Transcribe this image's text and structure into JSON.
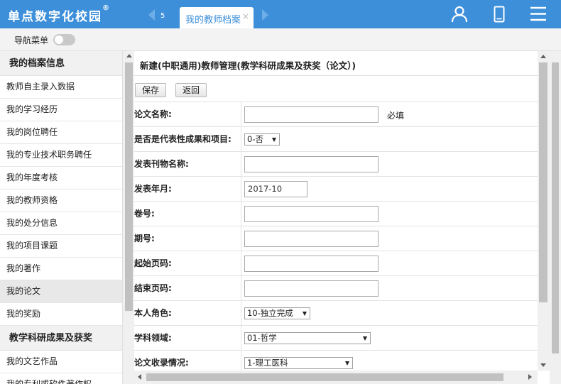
{
  "app": {
    "logo_text": "单点数字化校园",
    "logo_mark": "®"
  },
  "tabs": {
    "ghost_label": "5",
    "active_label": "我的教师档案",
    "close_glyph": "×"
  },
  "header_icons": [
    "user-icon",
    "mobile-icon",
    "menu-icon"
  ],
  "navbar": {
    "label": "导航菜单",
    "toggle_on": false
  },
  "sidebar": {
    "sections": [
      {
        "title": "我的档案信息",
        "items": [
          {
            "label": "教师自主录入数据",
            "active": false
          },
          {
            "label": "我的学习经历",
            "active": false
          },
          {
            "label": "我的岗位聘任",
            "active": false
          },
          {
            "label": "我的专业技术职务聘任",
            "active": false
          },
          {
            "label": "我的年度考核",
            "active": false
          },
          {
            "label": "我的教师资格",
            "active": false
          },
          {
            "label": "我的处分信息",
            "active": false
          },
          {
            "label": "我的项目课题",
            "active": false
          },
          {
            "label": "我的著作",
            "active": false
          },
          {
            "label": "我的论文",
            "active": true
          },
          {
            "label": "我的奖励",
            "active": false
          }
        ]
      },
      {
        "title": "教学科研成果及获奖",
        "items": [
          {
            "label": "我的文艺作品",
            "active": false
          },
          {
            "label": "我的专利或软件著作权",
            "active": false
          }
        ]
      }
    ]
  },
  "main": {
    "title": "新建(中职通用)教师管理(教学科研成果及获奖（论文）)",
    "buttons": {
      "save": "保存",
      "back": "返回"
    },
    "fields": [
      {
        "label": "论文名称:",
        "type": "text",
        "value": "",
        "required_note": "必填"
      },
      {
        "label": "是否是代表性成果和项目:",
        "type": "select",
        "value": "0-否"
      },
      {
        "label": "发表刊物名称:",
        "type": "text",
        "value": ""
      },
      {
        "label": "发表年月:",
        "type": "text-short",
        "value": "2017-10"
      },
      {
        "label": "卷号:",
        "type": "text",
        "value": ""
      },
      {
        "label": "期号:",
        "type": "text",
        "value": ""
      },
      {
        "label": "起始页码:",
        "type": "text",
        "value": ""
      },
      {
        "label": "结束页码:",
        "type": "text",
        "value": ""
      },
      {
        "label": "本人角色:",
        "type": "select",
        "value": "10-独立完成"
      },
      {
        "label": "学科领域:",
        "type": "select",
        "value": "01-哲学"
      },
      {
        "label": "论文收录情况:",
        "type": "select",
        "value": "1-理工医科"
      }
    ]
  },
  "colors": {
    "header_bg": "#3d8fd9",
    "tab_text": "#3d8fd9",
    "active_item_bg": "#e8e8e8"
  }
}
